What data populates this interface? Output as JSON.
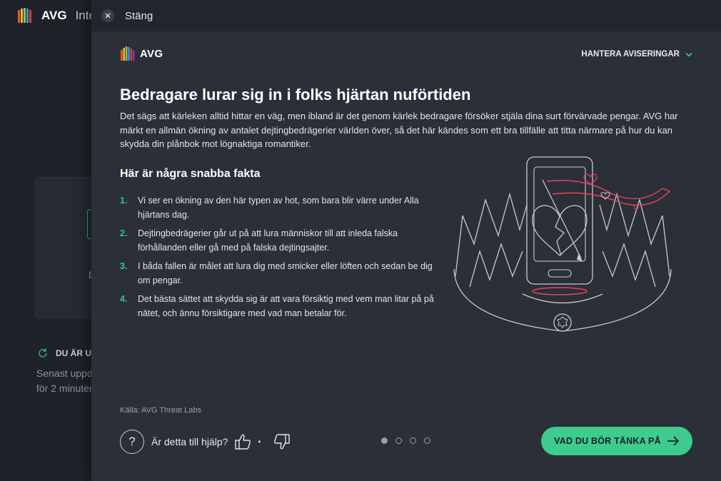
{
  "background_app": {
    "logo_text": "AVG",
    "title": "Inte",
    "card_letter": "D",
    "status_label": "DU ÄR UP",
    "update_line1": "Senast uppd",
    "update_line2": "för 2 minuter"
  },
  "modal": {
    "close_label": "Stäng",
    "brand": "AVG",
    "manage_label": "HANTERA AVISERINGAR",
    "headline": "Bedragare lurar sig in i folks hjärtan nuförtiden",
    "intro": "Det sägs att kärleken alltid hittar en väg, men ibland är det genom kärlek bedragare försöker stjäla dina surt förvärvade pengar. AVG har märkt en allmän ökning av antalet dejtingbedrägerier världen över, så det här kändes som ett bra tillfälle att titta närmare på hur du kan skydda din plånbok mot lögnaktiga romantiker.",
    "facts_title": "Här är några snabba fakta",
    "facts": [
      {
        "num": "1.",
        "text": "Vi ser en ökning av den här typen av hot, som bara blir värre under Alla hjärtans dag."
      },
      {
        "num": "2.",
        "text": "Dejtingbedrägerier går ut på att lura människor till att inleda falska förhållanden eller gå med på falska dejtingsajter."
      },
      {
        "num": "3.",
        "text": "I båda fallen är målet att lura dig med smicker eller löften och sedan be dig om pengar."
      },
      {
        "num": "4.",
        "text": "Det bästa sättet att skydda sig är att vara försiktig med vem man litar på på nätet, och ännu försiktigare med vad man betalar för."
      }
    ],
    "source": "Källa: AVG Threat Labs",
    "help_question_mark": "?",
    "help_label": "Är detta till hjälp?",
    "help_separator": "•",
    "pager": {
      "total": 4,
      "current": 1
    },
    "next_label": "VAD DU BÖR TÄNKA PÅ"
  },
  "colors": {
    "accent_green": "#3dcc8d",
    "modal_bg": "#2b2f38",
    "heart_red": "#e8455f"
  },
  "icons": [
    "close-icon",
    "avg-logo",
    "chevron-down-icon",
    "question-icon",
    "thumbs-up-icon",
    "thumbs-down-icon",
    "arrow-right-icon"
  ]
}
